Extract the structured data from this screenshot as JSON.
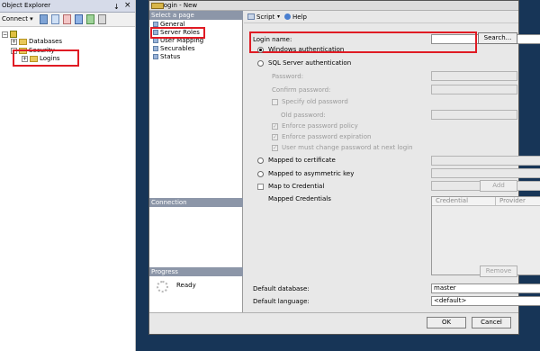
{
  "object_explorer": {
    "title": "Object Explorer",
    "pin": "↓",
    "close": "×",
    "connect_label": "Connect ▾",
    "tree": {
      "databases": "Databases",
      "security": "Security",
      "logins": "Logins"
    }
  },
  "dialog": {
    "title": "Login - New",
    "select_page_header": "Select a page",
    "pages": [
      "General",
      "Server Roles",
      "User Mapping",
      "Securables",
      "Status"
    ],
    "connection_header": "Connection",
    "progress_header": "Progress",
    "progress_status": "Ready",
    "toolbar": {
      "script": "Script",
      "help": "Help"
    },
    "form": {
      "login_name_label": "Login name:",
      "login_name_value": "",
      "search_button": "Search...",
      "windows_auth": "Windows authentication",
      "sql_auth": "SQL Server authentication",
      "password_label": "Password:",
      "confirm_password_label": "Confirm password:",
      "specify_old_password": "Specify old password",
      "old_password_label": "Old password:",
      "enforce_policy": "Enforce password policy",
      "enforce_expiration": "Enforce password expiration",
      "must_change": "User must change password at next login",
      "mapped_certificate": "Mapped to certificate",
      "mapped_asymmetric": "Mapped to asymmetric key",
      "map_credential": "Map to Credential",
      "add_button": "Add",
      "mapped_credentials_label": "Mapped Credentials",
      "credential_col": "Credential",
      "provider_col": "Provider",
      "remove_button": "Remove",
      "default_database_label": "Default database:",
      "default_database_value": "master",
      "default_language_label": "Default language:",
      "default_language_value": "<default>"
    },
    "ok_button": "OK",
    "cancel_button": "Cancel"
  },
  "colors": {
    "highlight": "#e01b24",
    "desktop": "#173557"
  }
}
